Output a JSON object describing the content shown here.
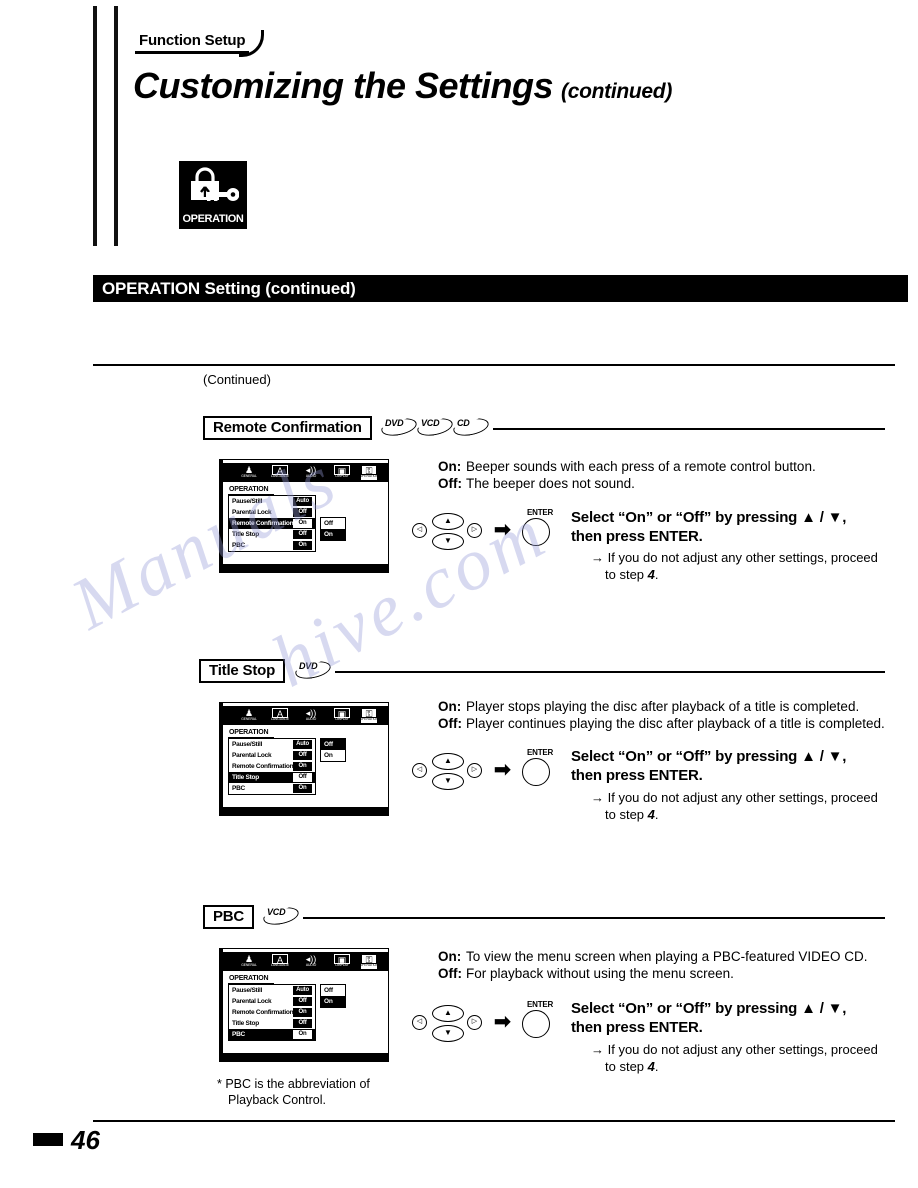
{
  "header": {
    "tab_label": "Function Setup",
    "title_main": "Customizing the Settings",
    "title_continued": "(continued)",
    "badge_caption": "OPERATION",
    "badge_icon": "padlock-key-icon"
  },
  "section_bar": {
    "label": "OPERATION Setting (continued)"
  },
  "continued_note": "(Continued)",
  "osd_menu": {
    "screen_title": "OPERATION",
    "iconbar": [
      {
        "name": "general-icon",
        "glyph": "♟",
        "sub": "GENERAL"
      },
      {
        "name": "language-icon",
        "glyph": "A",
        "sub": "LANGUAGE"
      },
      {
        "name": "audio-icon",
        "glyph": "◂))",
        "sub": "AUDIO"
      },
      {
        "name": "display-icon",
        "glyph": "▣",
        "sub": "DISPLAY"
      },
      {
        "name": "operation-icon",
        "glyph": "⚿",
        "sub": "OPERATION"
      }
    ],
    "rows": [
      {
        "name": "Pause/Still",
        "value": "Auto"
      },
      {
        "name": "Parental Lock",
        "value": "Off"
      },
      {
        "name": "Remote Confirmation",
        "value": "On"
      },
      {
        "name": "Title Stop",
        "value": "Off"
      },
      {
        "name": "PBC",
        "value": "On"
      }
    ],
    "popup_options": [
      "Off",
      "On"
    ]
  },
  "sections": [
    {
      "id": "remote-confirmation",
      "heading": "Remote Confirmation",
      "discs": [
        "DVD",
        "VCD",
        "CD"
      ],
      "highlight_row_index": 2,
      "popup_selected_index": 1,
      "descriptions": [
        {
          "label": "On:",
          "text": "Beeper sounds with each press of a remote control button."
        },
        {
          "label": "Off:",
          "text": "The beeper does not sound."
        }
      ],
      "instruction_line1": "Select “On” or “Off” by pressing ▲ / ▼,",
      "instruction_line2": "then press ENTER.",
      "substep_line1": "→ If you do not adjust any other settings, proceed",
      "substep_line2_prefix": "to step ",
      "substep_line2_step": "4",
      "substep_line2_suffix": "."
    },
    {
      "id": "title-stop",
      "heading": "Title Stop",
      "discs": [
        "DVD"
      ],
      "highlight_row_index": 3,
      "popup_selected_index": 0,
      "descriptions": [
        {
          "label": "On:",
          "text": "Player stops playing the disc after playback of a title is completed."
        },
        {
          "label": "Off:",
          "text": "Player continues playing the disc after playback of a title is completed."
        }
      ],
      "instruction_line1": "Select “On” or “Off” by pressing ▲ / ▼,",
      "instruction_line2": "then press ENTER.",
      "substep_line1": "→ If you do not adjust any other settings, proceed",
      "substep_line2_prefix": "to step ",
      "substep_line2_step": "4",
      "substep_line2_suffix": "."
    },
    {
      "id": "pbc",
      "heading": "PBC",
      "discs": [
        "VCD"
      ],
      "highlight_row_index": 4,
      "popup_selected_index": 1,
      "descriptions": [
        {
          "label": "On:",
          "text": "To view the menu screen when playing a PBC-featured VIDEO CD."
        },
        {
          "label": "Off:",
          "text": "For playback without using the menu screen."
        }
      ],
      "instruction_line1": "Select “On” or “Off” by pressing ▲ / ▼,",
      "instruction_line2": "then press ENTER.",
      "substep_line1": "→ If you do not adjust any other settings, proceed",
      "substep_line2_prefix": "to step ",
      "substep_line2_step": "4",
      "substep_line2_suffix": "."
    }
  ],
  "remote_keys": {
    "left_label": "◁",
    "up_label": "▲",
    "down_label": "▼",
    "right_label": "▷",
    "arrow": "➡",
    "enter_label": "ENTER"
  },
  "footnote": {
    "line1": "* PBC is the abbreviation of",
    "line2": "Playback Control."
  },
  "footer": {
    "page_number": "46"
  },
  "watermark": {
    "line1": "Manuals",
    "line2": "hive.com"
  }
}
